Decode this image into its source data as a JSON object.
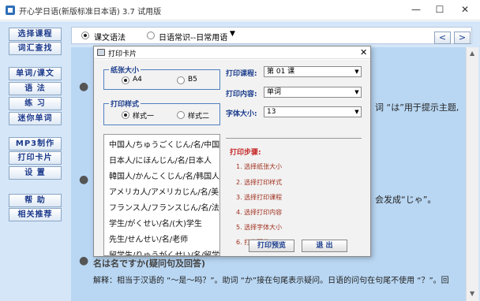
{
  "window": {
    "title": "开心学日语(新版标准日本语) 3.7 试用版",
    "minimize": "—",
    "maximize": "☐",
    "close": "✕"
  },
  "sidebar": {
    "items": [
      {
        "label": "选择课程"
      },
      {
        "label": "词汇查找"
      },
      {
        "label": "单词/课文"
      },
      {
        "label": "语 法"
      },
      {
        "label": "练 习"
      },
      {
        "label": "迷你单词"
      },
      {
        "label": "MP3制作"
      },
      {
        "label": "打印卡片"
      },
      {
        "label": "设 置"
      },
      {
        "label": "帮 助"
      },
      {
        "label": "相关推荐"
      }
    ]
  },
  "topbar": {
    "option1": "课文语法",
    "option2": "日语常识--日常用语",
    "selected": "option1",
    "prev": "<",
    "next": ">"
  },
  "content": {
    "fragment1": "词 “は”用于提示主题,",
    "fragment2": "会发成“じゃ”。",
    "heading3": "名は名ですか(疑问句及回答)",
    "line4": "解释：相当于汉语的 “～是～吗？”。助词 “か”接在句尾表示疑问。日语的问句在句尾不使用 “？”。回"
  },
  "dialog": {
    "title": "打印卡片",
    "close": "✕",
    "paper_size": {
      "legend": "纸张大小",
      "options": [
        "A4",
        "B5"
      ],
      "selected": "A4"
    },
    "print_style": {
      "legend": "打印样式",
      "options": [
        "样式一",
        "样式二"
      ],
      "selected": "样式一"
    },
    "list_items": [
      "中国人/ちゅうごくじん/名/中国",
      "日本人/にほんじん/名/日本人",
      "韓国人/かんこくじん/名/韩国人",
      "アメリカ人/アメリカじん/名/美国",
      "フランス人/フランスじん/名/法国",
      "学生/がくせい/名/(大)学生",
      "先生/せんせい/名/老师",
      "留学生/りゅうがくせい/名/留学"
    ],
    "fields": {
      "course": {
        "label": "打印课程:",
        "value": "第 01 课"
      },
      "content": {
        "label": "打印内容:",
        "value": "单词"
      },
      "font_size": {
        "label": "字体大小:",
        "value": "13"
      }
    },
    "steps_title": "打印步骤:",
    "steps": [
      "1. 选择纸张大小",
      "2. 选择打印样式",
      "3. 选择打印课程",
      "4. 选择打印内容",
      "5. 选择字体大小",
      "6. 打印预览"
    ],
    "buttons": {
      "preview": "打印预览",
      "exit": "退 出"
    }
  }
}
